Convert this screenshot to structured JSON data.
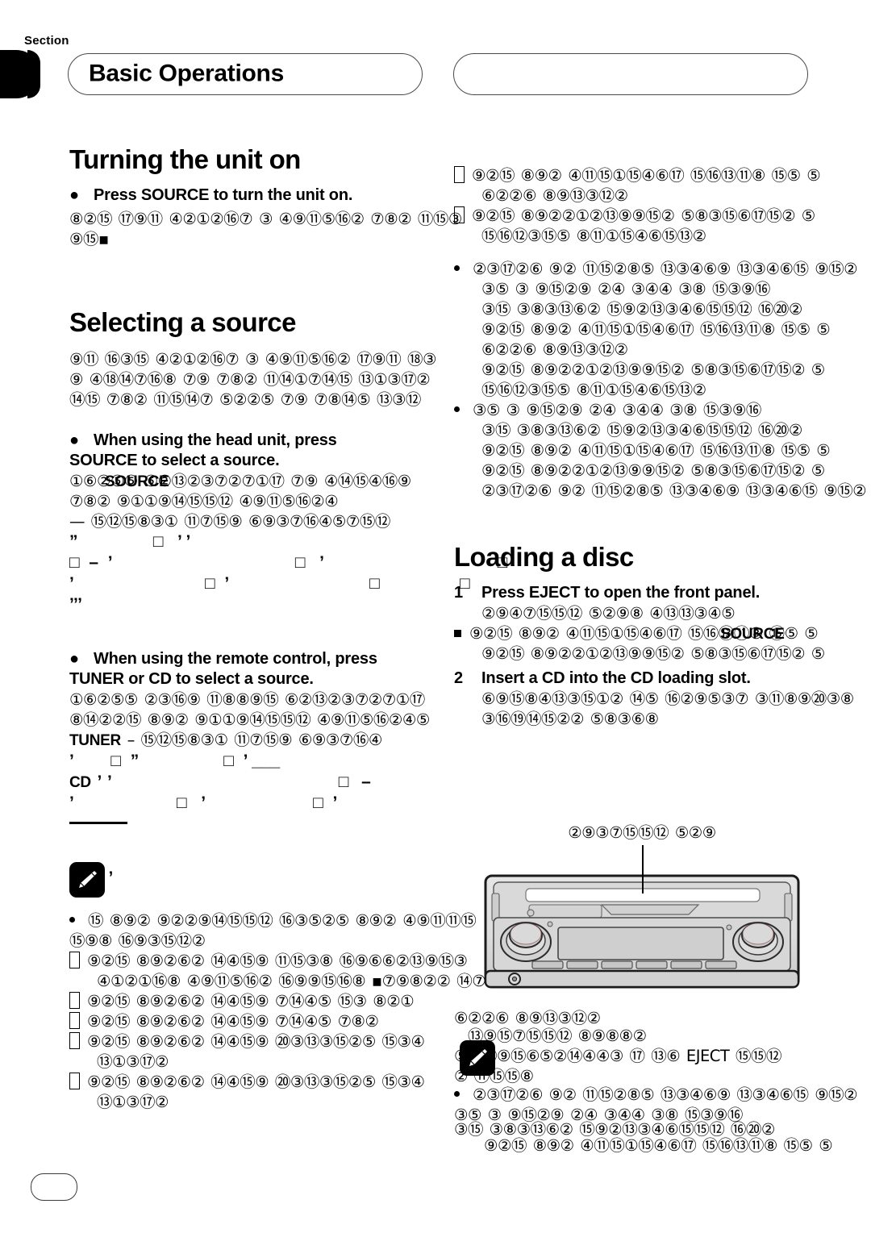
{
  "header": {
    "section_label": "Section",
    "title": "Basic Operations",
    "secondary_pill": "",
    "page_number": ""
  },
  "left_column": {
    "heading_1": "Turning the unit on",
    "bullet_1": {
      "marker": "●",
      "label": "Press SOURCE to turn the unit on.",
      "body_lines": [
        "⑧②⑮ ⑰⑨⑪ ④②①②⑯⑦ ③ ④⑨⑪⑤⑯② ⑦⑧② ⑪⑮③",
        "⑨⑮▪"
      ]
    },
    "heading_2": "Selecting a source",
    "intro_lines": [
      "⑨⑪ ⑯③⑮ ④②①②⑯⑦ ③ ④⑨⑪⑤⑯② ⑰⑨⑪ ⑱③",
      "⑨ ④⑱⑭⑦⑯⑧ ⑦⑨ ⑦⑧② ⑪⑭①⑦⑭⑮ ⑬①③⑰②",
      "⑭⑮ ⑦⑧② ⑪⑮⑭⑦ ⑤②②⑤ ⑦⑨ ⑦⑧⑭⑤ ⑬③⑫"
    ],
    "bullet_2": {
      "marker": "●",
      "label_line_1": "When using the head unit, press",
      "label_line_2": "SOURCE to select a source.",
      "overlay_keyword": "SOURCE",
      "body_lines": [
        "①⑥②⑤⑤ ⑥②⑬②③⑦②⑦①⑰ ⑦⑨ ④⑭⑮④⑯⑨",
        "⑦⑧② ⑨①①⑨⑭⑮⑮⑫ ④⑨⑪⑤⑯②④"
      ],
      "dash_line": "—   ⑮⑫⑮⑧③① ⑪⑦⑮⑨ ⑥⑨③⑦⑯④⑤⑦⑮⑫"
    },
    "debris_lines": [
      "”                □   ’ ’",
      "□  –  ’                                       □   ’                                     □",
      "’                            □  ’                              □                 □",
      "’’’"
    ],
    "bullet_3": {
      "marker": "●",
      "label_line_1": "When using the remote control, press",
      "label_line_2": "TUNER or CD to select a source.",
      "body_lines": [
        "①⑥②⑤⑤ ②③⑯⑨ ⑪⑧⑧⑨⑮ ⑥②⑬②③⑦②⑦①⑰",
        "⑧⑭②②⑮ ⑧⑨② ⑨①①⑨⑭⑮⑮⑫ ④⑨⑪⑤⑯②④⑤"
      ],
      "key_1": "TUNER",
      "key_1_line": "–       ⑮⑫⑮⑧③① ⑪⑦⑮⑨ ⑥⑨③⑦⑯④",
      "key_2": "CD"
    },
    "debris_lines_2": [
      "’        □  ”                  □  ’ ___",
      "’ ’                                    □  –",
      "’                      □   ’                       □  ’",
      "___"
    ],
    "note": {
      "icon": "pencil-note-icon",
      "quote": "’",
      "items": [
        "⑮ ⑧⑨② ⑨②②⑨⑭⑮⑮⑫ ⑯③⑤②⑤ ⑧⑨② ④⑨⑪⑪⑮",
        "⑮⑨⑧ ⑯⑨③⑮⑫②"
      ],
      "sub_items": [
        "⑨②⑮ ⑧⑨②⑥② ⑭④⑮⑨ ⑪⑮③⑧ ⑯⑨⑥⑥②⑬⑨⑮③",
        "④①②①⑯⑧ ④⑨⑪⑤⑯② ⑯⑨⑨⑮⑯⑧ ▪⑦⑨⑧②② ⑭⑦",
        "⑨②⑮ ⑧⑨②⑥② ⑭④⑮⑨ ⑦⑭④⑤ ⑮③ ⑧②①",
        "⑨②⑮ ⑧⑨②⑥② ⑭④⑮⑨ ⑦⑭④⑤ ⑦⑧②",
        "⑨②⑮ ⑧⑨②⑥② ⑭④⑮⑨ ⑳③⑬③⑮②⑤ ⑮③④",
        "⑬①③⑰②",
        "⑨②⑮ ⑧⑨②⑥② ⑭④⑮⑨ ⑳③⑬③⑮②⑤ ⑮③④",
        "⑬①③⑰②"
      ]
    }
  },
  "right_column": {
    "top_items": [
      "⑨②⑮ ⑧⑨② ④⑪⑮①⑮④⑥⑰ ⑮⑯⑬⑪⑧ ⑮⑤ ⑤",
      "⑥②②⑥ ⑧⑨⑬③⑫②",
      "⑨②⑮ ⑧⑨②②①②⑬⑨⑨⑮② ⑤⑧③⑮⑥⑰⑮② ⑤",
      "⑮⑯⑫③⑮⑤ ⑧⑪①⑮④⑥⑮⑬②"
    ],
    "loading_heading": "Loading a disc",
    "step_1": {
      "num": "1",
      "label": "Press EJECT to open the front panel.",
      "body": "②⑨④⑦⑮⑮⑫ ⑤②⑨⑧ ④⑬⑬③④⑤",
      "sub_marker": "▪",
      "sub_keyword": "SOURCE"
    },
    "step_2": {
      "num": "2",
      "label": "Insert a CD into the CD loading slot.",
      "body_lines": [
        "⑥⑨⑮⑧④⑬③⑮①② ⑭⑤ ⑯②⑨⑤③⑦ ③⑪⑧⑨⑳③⑧",
        "③⑯⑲⑭⑮②② ⑤⑧③⑥⑧"
      ],
      "callout": "②⑨③⑦⑮⑮⑫ ⑤②⑨"
    },
    "diagram": {
      "name": "car-stereo-head-unit",
      "caption_lines": [
        "⑬⑨⑮⑦⑮⑮⑫ ⑧⑨⑧⑧②",
        "⑤⑧⑭⑨⑮⑥⑤②⑭④④③ ⑰ ⑬⑥ EJECT ⑮⑮⑫",
        "② ⑪⑮⑮⑧"
      ],
      "keyword": "EJECT"
    },
    "note": {
      "icon": "pencil-note-icon",
      "items": [
        "②③⑰②⑥ ⑨② ⑪⑮②⑧⑤ ⑬③④⑥⑨ ⑬③④⑥⑮ ⑨⑮②",
        "③⑤ ③ ⑨⑮②⑨ ②④ ③④④ ③⑧ ⑮③⑨⑯",
        "③⑮ ③⑧③⑬⑥② ⑮⑨②⑬③④⑥⑮⑮⑫ ⑯⑳②"
      ]
    }
  }
}
